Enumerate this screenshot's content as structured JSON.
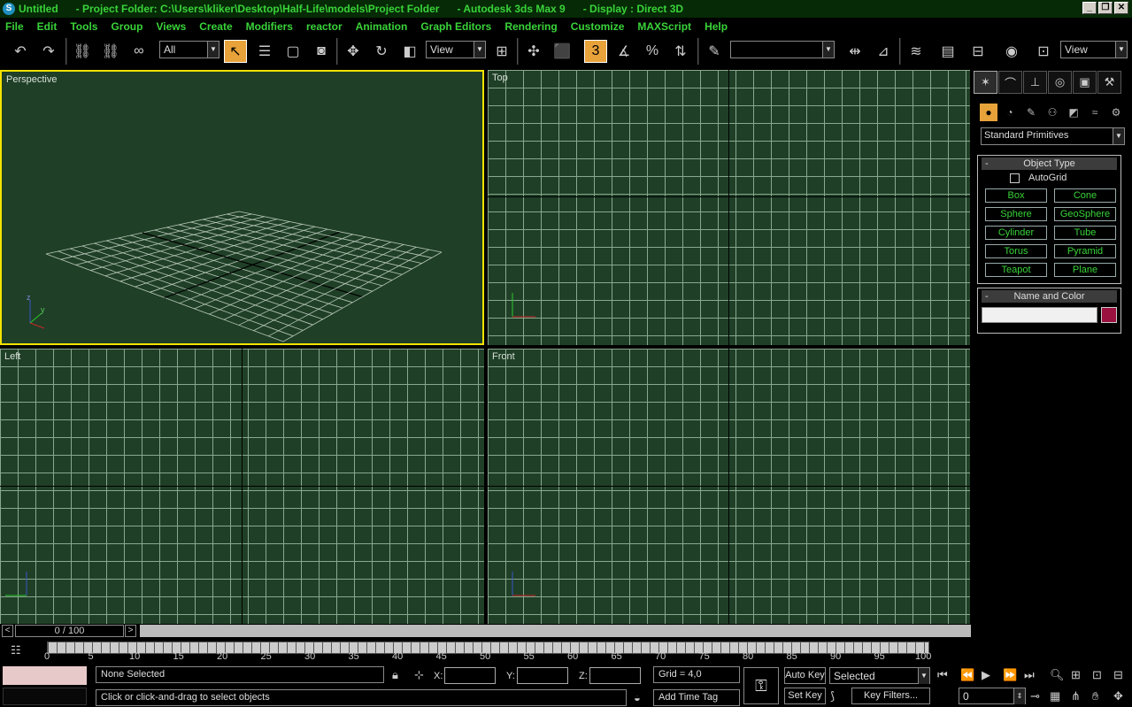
{
  "titlebar": {
    "app_icon": "3ds-max-logo-icon",
    "segments": [
      "Untitled",
      "- Project Folder: C:\\Users\\kliker\\Desktop\\Half-Life\\models\\Project Folder",
      "- Autodesk 3ds Max 9",
      "- Display : Direct 3D"
    ]
  },
  "menu": [
    "File",
    "Edit",
    "Tools",
    "Group",
    "Views",
    "Create",
    "Modifiers",
    "reactor",
    "Animation",
    "Graph Editors",
    "Rendering",
    "Customize",
    "MAXScript",
    "Help"
  ],
  "toolbar": {
    "selection_filter": "All",
    "ref_coord": "View",
    "snap_label": "3",
    "named_selection": "",
    "view_right": "View"
  },
  "viewports": {
    "perspective": "Perspective",
    "top": "Top",
    "left": "Left",
    "front": "Front"
  },
  "command_panel": {
    "category_dropdown": "Standard Primitives",
    "object_type": {
      "title": "Object Type",
      "autogrid": "AutoGrid",
      "buttons": [
        "Box",
        "Cone",
        "Sphere",
        "GeoSphere",
        "Cylinder",
        "Tube",
        "Torus",
        "Pyramid",
        "Teapot",
        "Plane"
      ]
    },
    "name_color": {
      "title": "Name and Color",
      "name_value": "",
      "color": "#9a1140"
    }
  },
  "timeline": {
    "frame_display": "0 / 100",
    "ticks": [
      "0",
      "5",
      "10",
      "15",
      "20",
      "25",
      "30",
      "35",
      "40",
      "45",
      "50",
      "55",
      "60",
      "65",
      "70",
      "75",
      "80",
      "85",
      "90",
      "95",
      "100"
    ]
  },
  "status": {
    "selection": "None Selected",
    "prompt": "Click or click-and-drag to select objects",
    "x_label": "X:",
    "y_label": "Y:",
    "z_label": "Z:",
    "grid": "Grid = 4,0",
    "add_time_tag": "Add Time Tag",
    "auto_key": "Auto Key",
    "set_key": "Set Key",
    "key_mode": "Selected",
    "key_filters": "Key Filters...",
    "current_frame": "0"
  }
}
